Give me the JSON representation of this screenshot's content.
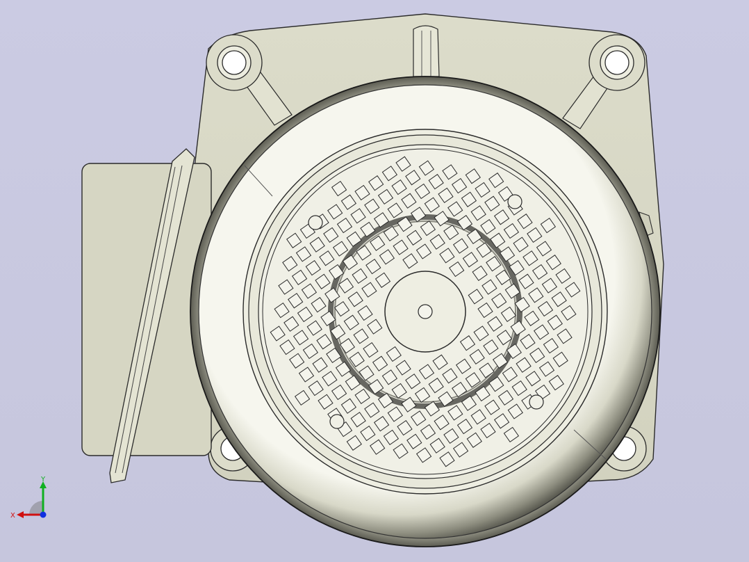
{
  "viewport": {
    "background": "#c9c9e0",
    "model": {
      "name": "electric-motor-fan-cover",
      "colors": {
        "body": "#d7d7c4",
        "edge": "#2a2a2a",
        "shade_light": "#f4f4ec",
        "shade_dark": "#6b6b60"
      }
    }
  },
  "triad": {
    "x_label": "X",
    "y_label": "Y",
    "colors": {
      "x": "#d01010",
      "y": "#10b020",
      "z": "#1030e0"
    }
  }
}
